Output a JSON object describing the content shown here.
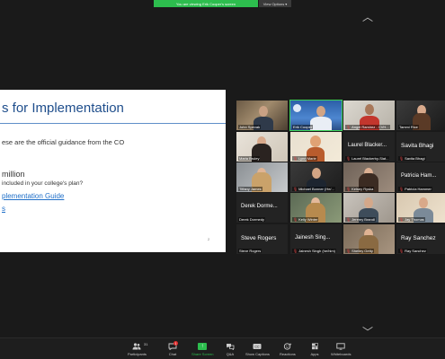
{
  "banner": {
    "sharing_text": "You are viewing Erik Cooper's screen",
    "view_options_label": "View Options"
  },
  "slide": {
    "title": "s for Implementation",
    "line1": "ese are the official guidance from the CO",
    "line_a": "million",
    "line_b": "included in your college's plan?",
    "line_c": "plementation Guide",
    "line_d": "s",
    "page_number": "2"
  },
  "gallery": {
    "tiles": [
      {
        "name": "John Spevak",
        "muted": false,
        "kind": "video"
      },
      {
        "name": "Erik Cooper",
        "muted": false,
        "kind": "video",
        "active": true
      },
      {
        "name": "Angel Ramirez - CVH...",
        "muted": true,
        "kind": "video"
      },
      {
        "name": "Tammi Rice",
        "muted": false,
        "kind": "video"
      },
      {
        "name": "Maria Bruley",
        "muted": false,
        "kind": "video"
      },
      {
        "name": "Lynn Marie",
        "muted": true,
        "kind": "video"
      },
      {
        "name": "Laurel Blackerby-Slat...",
        "muted": true,
        "kind": "text",
        "big": "Laurel Blacker..."
      },
      {
        "name": "Savita Bhagi",
        "muted": true,
        "kind": "text",
        "big": "Savita Bhagi"
      },
      {
        "name": "Tiffany James",
        "muted": false,
        "kind": "video"
      },
      {
        "name": "Michael Bonner (He/...",
        "muted": true,
        "kind": "video"
      },
      {
        "name": "Kelsey Ryska",
        "muted": true,
        "kind": "video"
      },
      {
        "name": "Patricia Hammer",
        "muted": true,
        "kind": "text",
        "big": "Patricia Ham..."
      },
      {
        "name": "Derek Dormedy",
        "muted": false,
        "kind": "text",
        "big": "Derek Dorme..."
      },
      {
        "name": "Kelly Winter",
        "muted": true,
        "kind": "video"
      },
      {
        "name": "Jeremy Brandl",
        "muted": true,
        "kind": "video"
      },
      {
        "name": "Jay Thomas",
        "muted": true,
        "kind": "video"
      },
      {
        "name": "Steve Rogers",
        "muted": false,
        "kind": "text",
        "big": "Steve Rogers"
      },
      {
        "name": "Jainesh Singh (he/him)",
        "muted": true,
        "kind": "text",
        "big": "Jainesh Sing..."
      },
      {
        "name": "Shelley Getty",
        "muted": true,
        "kind": "video"
      },
      {
        "name": "Ray Sanchez",
        "muted": true,
        "kind": "text",
        "big": "Ray Sanchez"
      }
    ]
  },
  "toolbar": {
    "participants_label": "Participants",
    "participants_count": "31",
    "chat_label": "Chat",
    "chat_badge": "1",
    "share_label": "Share Screen",
    "qa_label": "Q&A",
    "captions_label": "Show Captions",
    "reactions_label": "Reactions",
    "apps_label": "Apps",
    "whiteboards_label": "Whiteboards"
  },
  "colors": {
    "share_green": "#2dbd4e",
    "slide_title_blue": "#1f4e8c",
    "link_blue": "#1f6fc8",
    "mute_red": "#e04444"
  }
}
